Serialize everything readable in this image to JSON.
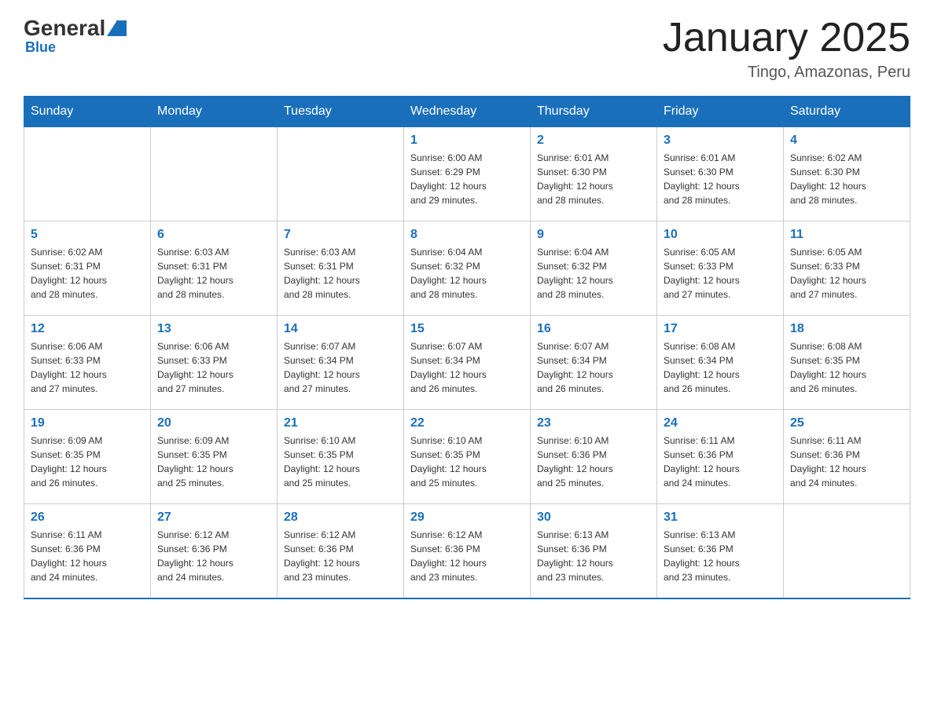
{
  "header": {
    "logo": {
      "general": "General",
      "blue": "Blue"
    },
    "title": "January 2025",
    "subtitle": "Tingo, Amazonas, Peru"
  },
  "days_of_week": [
    "Sunday",
    "Monday",
    "Tuesday",
    "Wednesday",
    "Thursday",
    "Friday",
    "Saturday"
  ],
  "weeks": [
    [
      {
        "day": "",
        "info": ""
      },
      {
        "day": "",
        "info": ""
      },
      {
        "day": "",
        "info": ""
      },
      {
        "day": "1",
        "info": "Sunrise: 6:00 AM\nSunset: 6:29 PM\nDaylight: 12 hours\nand 29 minutes."
      },
      {
        "day": "2",
        "info": "Sunrise: 6:01 AM\nSunset: 6:30 PM\nDaylight: 12 hours\nand 28 minutes."
      },
      {
        "day": "3",
        "info": "Sunrise: 6:01 AM\nSunset: 6:30 PM\nDaylight: 12 hours\nand 28 minutes."
      },
      {
        "day": "4",
        "info": "Sunrise: 6:02 AM\nSunset: 6:30 PM\nDaylight: 12 hours\nand 28 minutes."
      }
    ],
    [
      {
        "day": "5",
        "info": "Sunrise: 6:02 AM\nSunset: 6:31 PM\nDaylight: 12 hours\nand 28 minutes."
      },
      {
        "day": "6",
        "info": "Sunrise: 6:03 AM\nSunset: 6:31 PM\nDaylight: 12 hours\nand 28 minutes."
      },
      {
        "day": "7",
        "info": "Sunrise: 6:03 AM\nSunset: 6:31 PM\nDaylight: 12 hours\nand 28 minutes."
      },
      {
        "day": "8",
        "info": "Sunrise: 6:04 AM\nSunset: 6:32 PM\nDaylight: 12 hours\nand 28 minutes."
      },
      {
        "day": "9",
        "info": "Sunrise: 6:04 AM\nSunset: 6:32 PM\nDaylight: 12 hours\nand 28 minutes."
      },
      {
        "day": "10",
        "info": "Sunrise: 6:05 AM\nSunset: 6:33 PM\nDaylight: 12 hours\nand 27 minutes."
      },
      {
        "day": "11",
        "info": "Sunrise: 6:05 AM\nSunset: 6:33 PM\nDaylight: 12 hours\nand 27 minutes."
      }
    ],
    [
      {
        "day": "12",
        "info": "Sunrise: 6:06 AM\nSunset: 6:33 PM\nDaylight: 12 hours\nand 27 minutes."
      },
      {
        "day": "13",
        "info": "Sunrise: 6:06 AM\nSunset: 6:33 PM\nDaylight: 12 hours\nand 27 minutes."
      },
      {
        "day": "14",
        "info": "Sunrise: 6:07 AM\nSunset: 6:34 PM\nDaylight: 12 hours\nand 27 minutes."
      },
      {
        "day": "15",
        "info": "Sunrise: 6:07 AM\nSunset: 6:34 PM\nDaylight: 12 hours\nand 26 minutes."
      },
      {
        "day": "16",
        "info": "Sunrise: 6:07 AM\nSunset: 6:34 PM\nDaylight: 12 hours\nand 26 minutes."
      },
      {
        "day": "17",
        "info": "Sunrise: 6:08 AM\nSunset: 6:34 PM\nDaylight: 12 hours\nand 26 minutes."
      },
      {
        "day": "18",
        "info": "Sunrise: 6:08 AM\nSunset: 6:35 PM\nDaylight: 12 hours\nand 26 minutes."
      }
    ],
    [
      {
        "day": "19",
        "info": "Sunrise: 6:09 AM\nSunset: 6:35 PM\nDaylight: 12 hours\nand 26 minutes."
      },
      {
        "day": "20",
        "info": "Sunrise: 6:09 AM\nSunset: 6:35 PM\nDaylight: 12 hours\nand 25 minutes."
      },
      {
        "day": "21",
        "info": "Sunrise: 6:10 AM\nSunset: 6:35 PM\nDaylight: 12 hours\nand 25 minutes."
      },
      {
        "day": "22",
        "info": "Sunrise: 6:10 AM\nSunset: 6:35 PM\nDaylight: 12 hours\nand 25 minutes."
      },
      {
        "day": "23",
        "info": "Sunrise: 6:10 AM\nSunset: 6:36 PM\nDaylight: 12 hours\nand 25 minutes."
      },
      {
        "day": "24",
        "info": "Sunrise: 6:11 AM\nSunset: 6:36 PM\nDaylight: 12 hours\nand 24 minutes."
      },
      {
        "day": "25",
        "info": "Sunrise: 6:11 AM\nSunset: 6:36 PM\nDaylight: 12 hours\nand 24 minutes."
      }
    ],
    [
      {
        "day": "26",
        "info": "Sunrise: 6:11 AM\nSunset: 6:36 PM\nDaylight: 12 hours\nand 24 minutes."
      },
      {
        "day": "27",
        "info": "Sunrise: 6:12 AM\nSunset: 6:36 PM\nDaylight: 12 hours\nand 24 minutes."
      },
      {
        "day": "28",
        "info": "Sunrise: 6:12 AM\nSunset: 6:36 PM\nDaylight: 12 hours\nand 23 minutes."
      },
      {
        "day": "29",
        "info": "Sunrise: 6:12 AM\nSunset: 6:36 PM\nDaylight: 12 hours\nand 23 minutes."
      },
      {
        "day": "30",
        "info": "Sunrise: 6:13 AM\nSunset: 6:36 PM\nDaylight: 12 hours\nand 23 minutes."
      },
      {
        "day": "31",
        "info": "Sunrise: 6:13 AM\nSunset: 6:36 PM\nDaylight: 12 hours\nand 23 minutes."
      },
      {
        "day": "",
        "info": ""
      }
    ]
  ]
}
